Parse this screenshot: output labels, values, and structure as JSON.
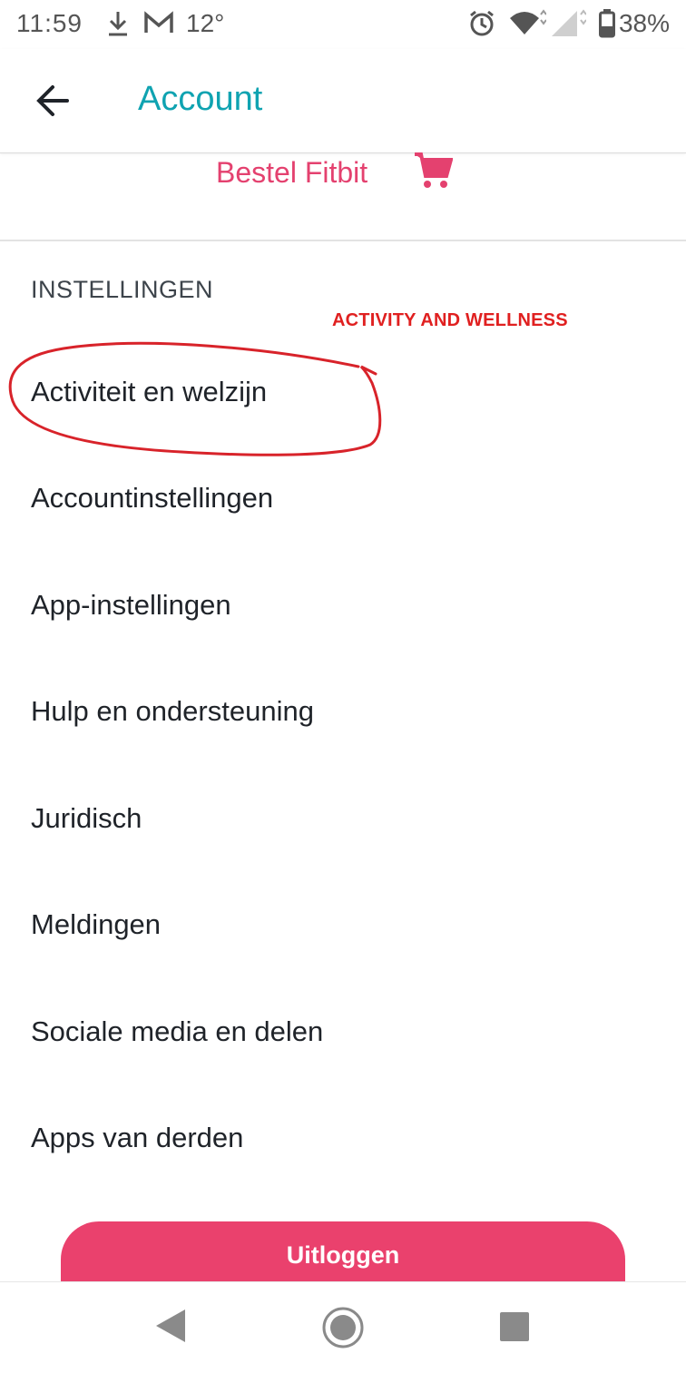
{
  "status_bar": {
    "time": "11:59",
    "temperature": "12°",
    "battery": "38%",
    "icons": [
      "download-icon",
      "gmail-icon",
      "alarm-icon",
      "wifi-icon",
      "signal-icon",
      "battery-icon"
    ]
  },
  "app_bar": {
    "title": "Account",
    "title_color": "#0fa3b1"
  },
  "shop": {
    "label": "Bestel Fitbit",
    "color": "#e4416f"
  },
  "settings": {
    "heading": "INSTELLINGEN",
    "annotation": "ACTIVITY AND WELLNESS",
    "items": [
      {
        "label": "Activiteit en welzijn"
      },
      {
        "label": "Accountinstellingen"
      },
      {
        "label": "App-instellingen"
      },
      {
        "label": "Hulp en ondersteuning"
      },
      {
        "label": "Juridisch"
      },
      {
        "label": "Meldingen"
      },
      {
        "label": "Sociale media en delen"
      },
      {
        "label": "Apps van derden"
      }
    ]
  },
  "logout": {
    "label": "Uitloggen",
    "color": "#ea416d"
  }
}
